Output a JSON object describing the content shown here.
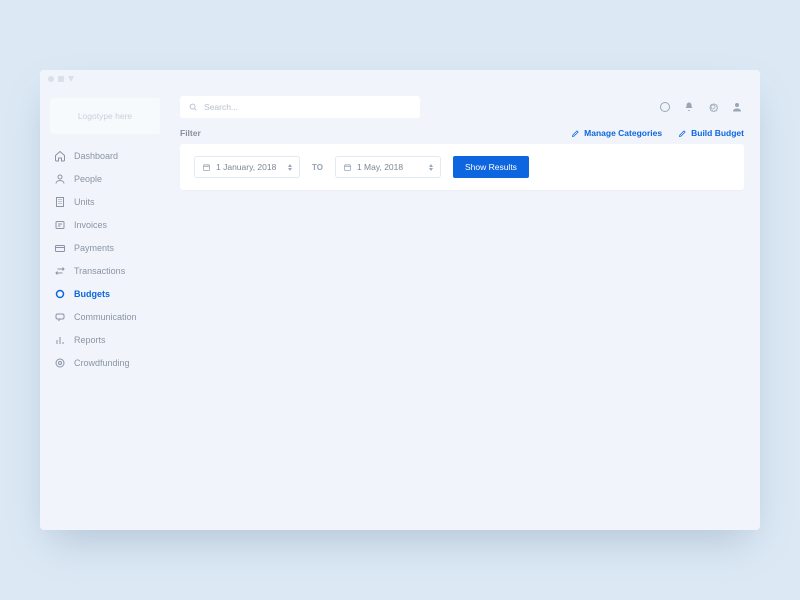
{
  "logo": {
    "text": "Logotype here"
  },
  "search": {
    "placeholder": "Search..."
  },
  "sidebar": {
    "items": [
      {
        "label": "Dashboard"
      },
      {
        "label": "People"
      },
      {
        "label": "Units"
      },
      {
        "label": "Invoices"
      },
      {
        "label": "Payments"
      },
      {
        "label": "Transactions"
      },
      {
        "label": "Budgets"
      },
      {
        "label": "Communication"
      },
      {
        "label": "Reports"
      },
      {
        "label": "Crowdfunding"
      }
    ]
  },
  "filter": {
    "heading": "Filter",
    "to_label": "TO",
    "date_from": "1 January, 2018",
    "date_to": "1 May, 2018",
    "show_results": "Show Results",
    "manage_categories": "Manage Categories",
    "build_budget": "Build Budget"
  },
  "colors": {
    "accent": "#0d66e0"
  }
}
